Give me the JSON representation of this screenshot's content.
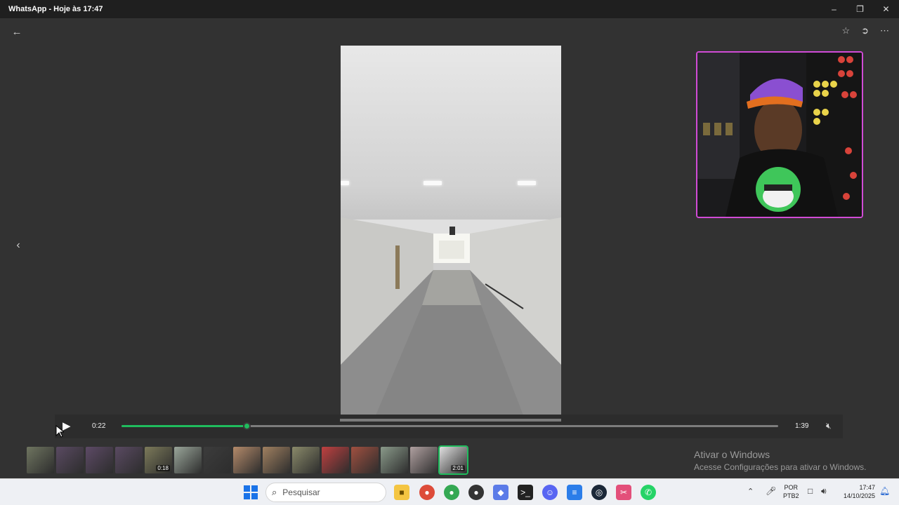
{
  "window": {
    "title": "WhatsApp - Hoje às 17:47",
    "minimize_icon": "minimize-icon",
    "maximize_icon": "restore-icon",
    "close_icon": "close-icon"
  },
  "viewer": {
    "back_icon": "arrow-left-icon",
    "prev_icon": "chevron-left-icon",
    "header_icons": [
      "star-icon",
      "forward-icon",
      "more-icon"
    ]
  },
  "player": {
    "current_time": "0:22",
    "duration": "1:39",
    "progress": 0.19,
    "play_icon": "play-icon",
    "mute_icon": "muted-icon",
    "accent_color": "#1fbc5d"
  },
  "thumbnails": [
    {
      "duration": "",
      "active": false
    },
    {
      "duration": "",
      "active": false
    },
    {
      "duration": "",
      "active": false
    },
    {
      "duration": "",
      "active": false
    },
    {
      "duration": "0:18",
      "active": false
    },
    {
      "duration": "",
      "active": false
    },
    {
      "duration": "",
      "active": false
    },
    {
      "duration": "",
      "active": false
    },
    {
      "duration": "",
      "active": false
    },
    {
      "duration": "",
      "active": false
    },
    {
      "duration": "",
      "active": false
    },
    {
      "duration": "",
      "active": false
    },
    {
      "duration": "",
      "active": false
    },
    {
      "duration": "",
      "active": false
    },
    {
      "duration": "2:01",
      "active": true
    }
  ],
  "watermark": {
    "line1": "Ativar o Windows",
    "line2": "Acesse Configurações para ativar o Windows."
  },
  "taskbar": {
    "search_placeholder": "Pesquisar",
    "lang_line1": "POR",
    "lang_line2": "PTB2",
    "time": "17:47",
    "date": "14/10/2025"
  }
}
